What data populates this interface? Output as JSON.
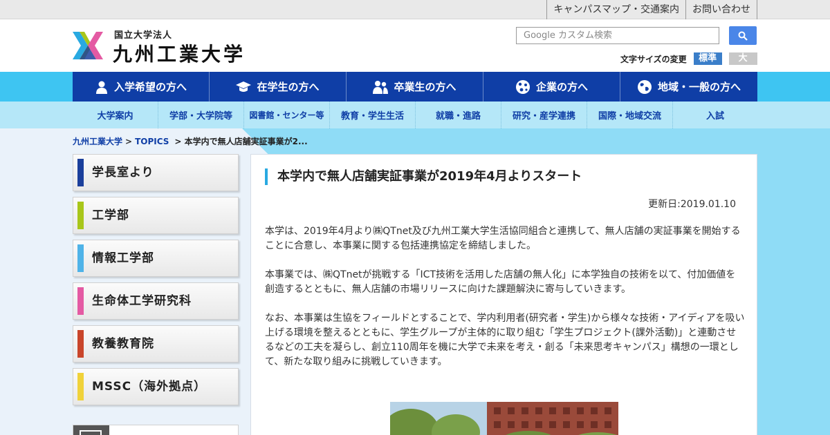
{
  "utility_links": [
    "キャンパスマップ・交通案内",
    "お問い合わせ"
  ],
  "logo": {
    "subtitle": "国立大学法人",
    "name": "九州工業大学"
  },
  "search": {
    "placeholder": "Google カスタム検索"
  },
  "font_size": {
    "label": "文字サイズの変更",
    "normal": "標準",
    "large": "大"
  },
  "main_nav": [
    {
      "label": "入学希望の方へ",
      "icon": "person-icon"
    },
    {
      "label": "在学生の方へ",
      "icon": "graduation-cap-icon"
    },
    {
      "label": "卒業生の方へ",
      "icon": "people-icon"
    },
    {
      "label": "企業の方へ",
      "icon": "network-globe-icon"
    },
    {
      "label": "地域・一般の方へ",
      "icon": "globe-icon"
    }
  ],
  "sub_nav": [
    "大学案内",
    "学部・大学院等",
    "図書館・センター等",
    "教育・学生生活",
    "就職・進路",
    "研究・産学連携",
    "国際・地域交流",
    "入試"
  ],
  "breadcrumb": {
    "home": "九州工業大学",
    "section": "TOPICS",
    "current": "本学内で無人店舗実証事業が2..."
  },
  "sidebar": [
    {
      "label": "学長室より",
      "color": "#1b3f9b"
    },
    {
      "label": "工学部",
      "color": "#a8c61a"
    },
    {
      "label": "情報工学部",
      "color": "#4fb3e8"
    },
    {
      "label": "生命体工学研究科",
      "color": "#e45aa3"
    },
    {
      "label": "教養教育院",
      "color": "#c9452a"
    },
    {
      "label": "MSSC（海外拠点）",
      "color": "#f0d23a"
    }
  ],
  "article": {
    "title": "本学内で無人店舗実証事業が2019年4月よりスタート",
    "updated": "更新日:2019.01.10",
    "paragraphs": [
      "本学は、2019年4月より㈱QTnet及び九州工業大学生活協同組合と連携して、無人店舗の実証事業を開始することに合意し、本事業に関する包括連携協定を締結しました。",
      "本事業では、㈱QTnetが挑戦する「ICT技術を活用した店舗の無人化」に本学独自の技術を以て、付加価値を創造するとともに、無人店舗の市場リリースに向けた課題解決に寄与していきます。",
      "なお、本事業は生協をフィールドとすることで、学内利用者(研究者・学生)から様々な技術・アイディアを吸い上げる環境を整えるとともに、学生グループが主体的に取り組む「学生プロジェクト(課外活動)」と連動させるなどの工夫を凝らし、創立110周年を機に大学で未来を考え・創る「未来思考キャンパス」構想の一環として、新たな取り組みに挑戦していきます。"
    ]
  },
  "colors": {
    "primary_nav": "#0f3ea6",
    "accent_cyan": "#3ec5f2",
    "subnav_bg": "#b5e7f8",
    "search_button": "#4a86e8"
  }
}
